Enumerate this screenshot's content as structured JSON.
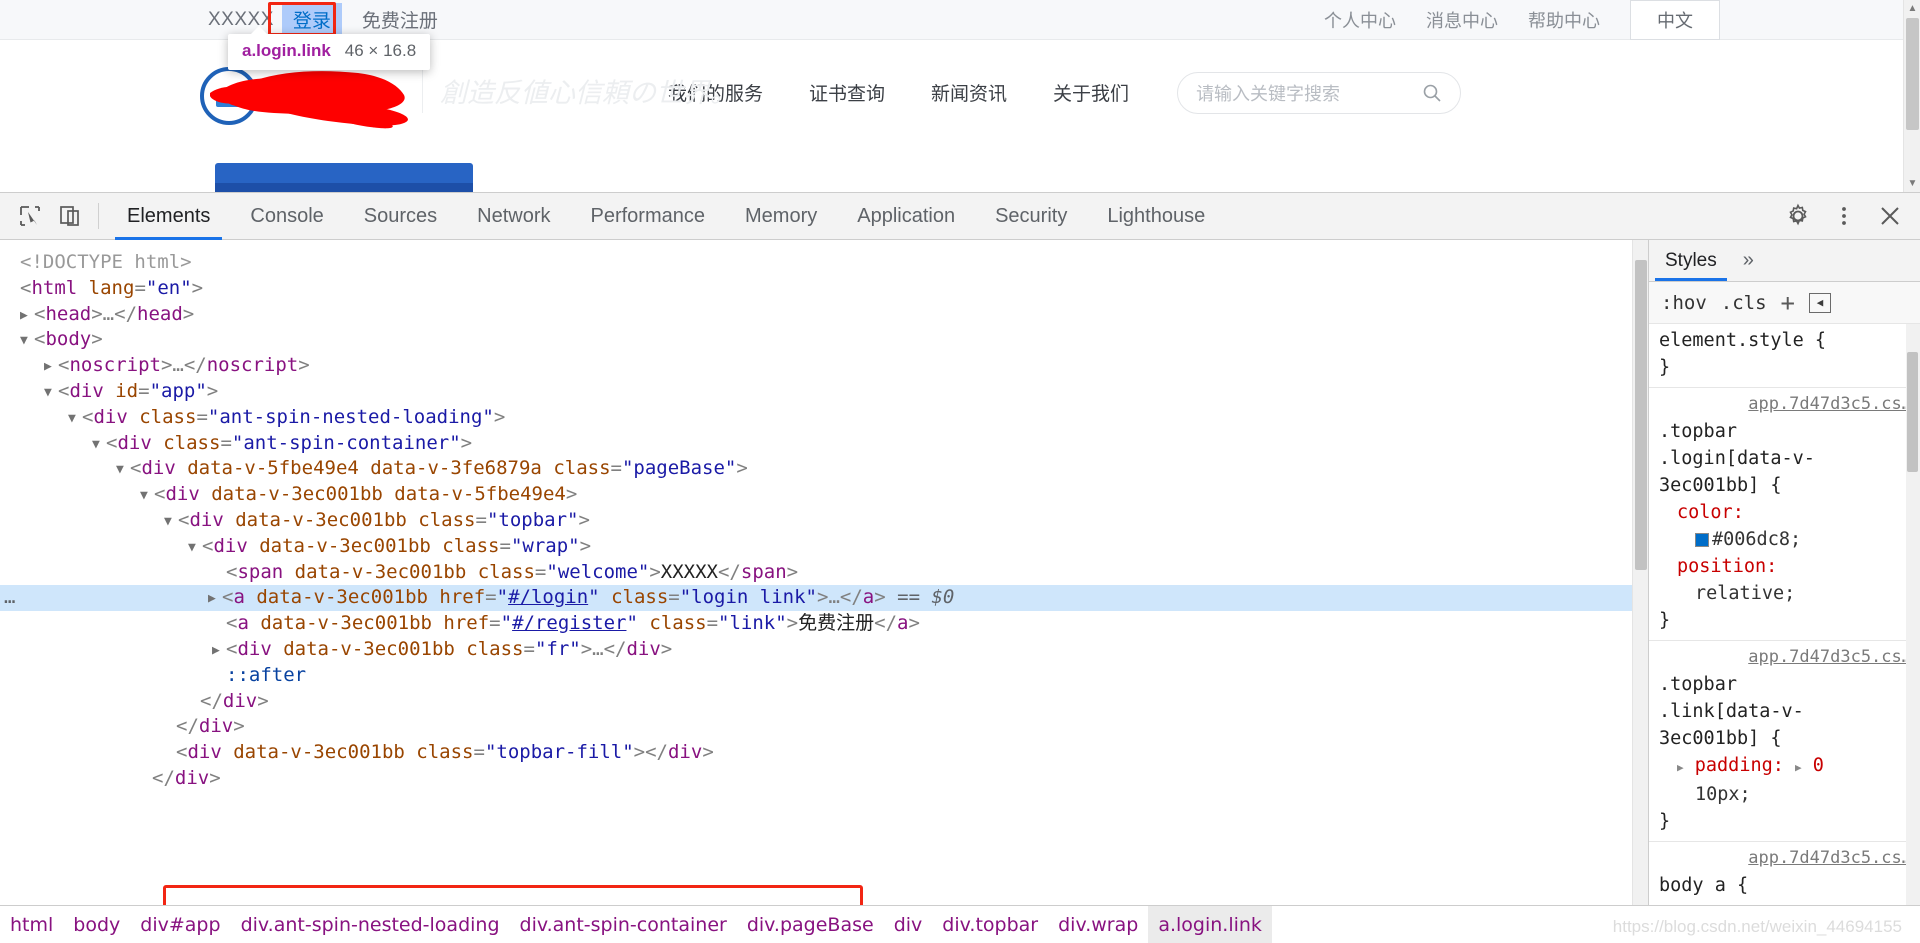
{
  "page": {
    "topbar": {
      "welcome": "XXXXX",
      "login_label": "登录",
      "register_label": "免费注册",
      "right_links": [
        "个人中心",
        "消息中心",
        "帮助中心"
      ],
      "language": "中文"
    },
    "inspect_tooltip": {
      "selector": "a.login.link",
      "dimensions": "46 × 16.8"
    },
    "header": {
      "tagline": "創造反値心信頼の世界。",
      "nav": [
        "我们的服务",
        "证书查询",
        "新闻资讯",
        "关于我们"
      ],
      "search_placeholder": "请输入关键字搜索",
      "search_icon": "search-icon"
    }
  },
  "devtools": {
    "toolbar": {
      "inspect_icon": "inspect-element-icon",
      "device_icon": "device-toolbar-icon",
      "settings_icon": "gear-icon",
      "more_icon": "more-vertical-icon",
      "close_icon": "close-icon",
      "tabs": [
        "Elements",
        "Console",
        "Sources",
        "Network",
        "Performance",
        "Memory",
        "Application",
        "Security",
        "Lighthouse"
      ],
      "active_tab": "Elements"
    },
    "dom": {
      "lines": [
        "<!DOCTYPE html>",
        "<html lang=\"en\">",
        "<head>…</head>",
        "<body>",
        "<noscript>…</noscript>",
        "<div id=\"app\">",
        "<div class=\"ant-spin-nested-loading\">",
        "<div class=\"ant-spin-container\">",
        "<div data-v-5fbe49e4 data-v-3fe6879a class=\"pageBase\">",
        "<div data-v-3ec001bb data-v-5fbe49e4>",
        "<div data-v-3ec001bb class=\"topbar\">",
        "<div data-v-3ec001bb class=\"wrap\">",
        "<span data-v-3ec001bb class=\"welcome\">XXXXX</span>",
        "<a data-v-3ec001bb href=\"#/login\" class=\"login link\">…</a> == $0",
        "<a data-v-3ec001bb href=\"#/register\" class=\"link\">免费注册</a>",
        "<div data-v-3ec001bb class=\"fr\">…</div>",
        "::after",
        "</div>",
        "</div>",
        "<div data-v-3ec001bb class=\"topbar-fill\"></div>",
        "</div>"
      ],
      "selected_line_index": 13,
      "selected_marker": "== $0",
      "ellipsis_menu": "…"
    },
    "styles": {
      "tab_label": "Styles",
      "more_label": "»",
      "toolbar": {
        "hov": ":hov",
        "cls": ".cls",
        "add_rule": "+",
        "toggle_sidebar": "◀|"
      },
      "rules": [
        {
          "source": "",
          "selector": "element.style {",
          "close": "}",
          "declarations": []
        },
        {
          "source": "app.7d47d3c5.cs…",
          "selector": ".topbar .login[data-v-3ec001bb] {",
          "close": "}",
          "declarations": [
            {
              "prop": "color:",
              "value": "#006dc8;",
              "swatch": "#006dc8"
            },
            {
              "prop": "position:",
              "value": "relative;",
              "swatch": ""
            }
          ]
        },
        {
          "source": "app.7d47d3c5.cs…",
          "selector": ".topbar .link[data-v-3ec001bb] {",
          "close": "}",
          "declarations": [
            {
              "prop": "padding:",
              "value": "0 10px;",
              "swatch": ""
            }
          ]
        },
        {
          "source": "app.7d47d3c5.cs…",
          "selector": "body a {",
          "close": "",
          "declarations": []
        }
      ]
    },
    "breadcrumb": {
      "items": [
        "html",
        "body",
        "div#app",
        "div.ant-spin-nested-loading",
        "div.ant-spin-container",
        "div.pageBase",
        "div",
        "div.topbar",
        "div.wrap",
        "a.login.link"
      ],
      "active": "a.login.link"
    },
    "watermark": "https://blog.csdn.net/weixin_44694155"
  }
}
